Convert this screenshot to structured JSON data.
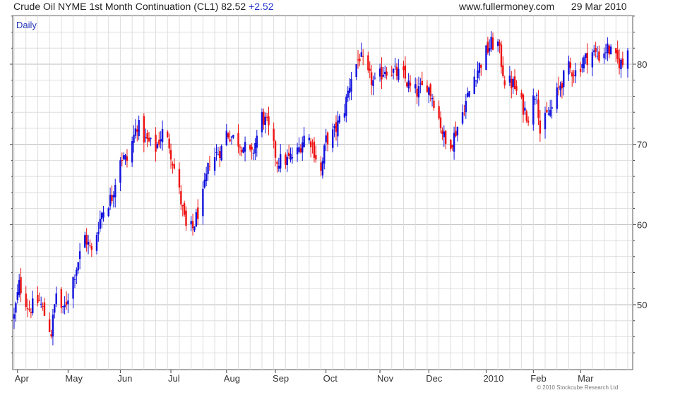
{
  "header": {
    "title": "Crude Oil NYME 1st Month Continuation (CL1)",
    "last": "82.52",
    "change": "+2.52",
    "site": "www.fullermoney.com",
    "date": "29 Mar 2010"
  },
  "copyright": "© 2010 Stockcube Research Ltd",
  "chart_data": {
    "type": "candlestick",
    "period_label": "Daily",
    "colors": {
      "up": "#1010dd",
      "down": "#ee1111",
      "grid": "#dddddd",
      "major_grid": "#bbbbbb",
      "axis": "#444444"
    },
    "y_ticks": [
      "50",
      "60",
      "70",
      "80"
    ],
    "ylim": [
      43,
      86
    ],
    "x_ticks": [
      {
        "label": "Apr",
        "date": "2009-04-01"
      },
      {
        "label": "May",
        "date": "2009-05-01"
      },
      {
        "label": "Jun",
        "date": "2009-06-01"
      },
      {
        "label": "Jul",
        "date": "2009-07-01"
      },
      {
        "label": "Aug",
        "date": "2009-08-03"
      },
      {
        "label": "Sep",
        "date": "2009-09-01"
      },
      {
        "label": "Oct",
        "date": "2009-10-01"
      },
      {
        "label": "Nov",
        "date": "2009-11-02"
      },
      {
        "label": "Dec",
        "date": "2009-12-01"
      },
      {
        "label": "2010",
        "date": "2010-01-04"
      },
      {
        "label": "Feb",
        "date": "2010-02-01"
      },
      {
        "label": "Mar",
        "date": "2010-03-01"
      }
    ],
    "end_date": "2010-03-29",
    "close_anchors": [
      [
        "2009-03-30",
        48.5
      ],
      [
        "2009-04-02",
        52.5
      ],
      [
        "2009-04-08",
        49.5
      ],
      [
        "2009-04-14",
        50.5
      ],
      [
        "2009-04-21",
        46.5
      ],
      [
        "2009-04-24",
        51.5
      ],
      [
        "2009-04-28",
        49.0
      ],
      [
        "2009-05-05",
        54.0
      ],
      [
        "2009-05-11",
        58.5
      ],
      [
        "2009-05-15",
        56.5
      ],
      [
        "2009-05-21",
        61.5
      ],
      [
        "2009-05-27",
        63.5
      ],
      [
        "2009-06-01",
        68.5
      ],
      [
        "2009-06-05",
        68.0
      ],
      [
        "2009-06-11",
        72.5
      ],
      [
        "2009-06-16",
        70.5
      ],
      [
        "2009-06-22",
        69.5
      ],
      [
        "2009-06-26",
        71.5
      ],
      [
        "2009-06-30",
        70.0
      ],
      [
        "2009-07-06",
        64.0
      ],
      [
        "2009-07-10",
        59.5
      ],
      [
        "2009-07-14",
        59.5
      ],
      [
        "2009-07-20",
        63.5
      ],
      [
        "2009-07-24",
        68.0
      ],
      [
        "2009-07-27",
        68.5
      ],
      [
        "2009-07-31",
        69.5
      ],
      [
        "2009-08-03",
        71.5
      ],
      [
        "2009-08-06",
        71.0
      ],
      [
        "2009-08-12",
        70.0
      ],
      [
        "2009-08-18",
        68.5
      ],
      [
        "2009-08-24",
        73.5
      ],
      [
        "2009-08-27",
        72.5
      ],
      [
        "2009-09-02",
        68.0
      ],
      [
        "2009-09-08",
        68.0
      ],
      [
        "2009-09-14",
        69.0
      ],
      [
        "2009-09-18",
        71.0
      ],
      [
        "2009-09-22",
        70.5
      ],
      [
        "2009-09-28",
        66.5
      ],
      [
        "2009-10-01",
        70.5
      ],
      [
        "2009-10-06",
        71.5
      ],
      [
        "2009-10-12",
        74.5
      ],
      [
        "2009-10-16",
        78.5
      ],
      [
        "2009-10-21",
        81.0
      ],
      [
        "2009-10-26",
        78.5
      ],
      [
        "2009-10-30",
        77.5
      ],
      [
        "2009-11-05",
        79.5
      ],
      [
        "2009-11-10",
        79.0
      ],
      [
        "2009-11-16",
        78.5
      ],
      [
        "2009-11-20",
        77.0
      ],
      [
        "2009-11-24",
        76.5
      ],
      [
        "2009-11-30",
        77.5
      ],
      [
        "2009-12-04",
        75.5
      ],
      [
        "2009-12-08",
        72.5
      ],
      [
        "2009-12-11",
        70.0
      ],
      [
        "2009-12-15",
        70.5
      ],
      [
        "2009-12-21",
        74.0
      ],
      [
        "2009-12-28",
        78.5
      ],
      [
        "2010-01-04",
        81.5
      ],
      [
        "2010-01-07",
        82.5
      ],
      [
        "2010-01-11",
        82.5
      ],
      [
        "2010-01-15",
        78.0
      ],
      [
        "2010-01-20",
        77.5
      ],
      [
        "2010-01-25",
        75.0
      ],
      [
        "2010-01-29",
        73.5
      ],
      [
        "2010-02-03",
        77.0
      ],
      [
        "2010-02-05",
        71.5
      ],
      [
        "2010-02-09",
        73.5
      ],
      [
        "2010-02-12",
        74.5
      ],
      [
        "2010-02-17",
        77.5
      ],
      [
        "2010-02-22",
        79.5
      ],
      [
        "2010-02-26",
        79.0
      ],
      [
        "2010-03-03",
        80.5
      ],
      [
        "2010-03-08",
        81.5
      ],
      [
        "2010-03-12",
        81.0
      ],
      [
        "2010-03-17",
        82.0
      ],
      [
        "2010-03-22",
        80.5
      ],
      [
        "2010-03-26",
        80.0
      ],
      [
        "2010-03-29",
        82.5
      ]
    ]
  }
}
